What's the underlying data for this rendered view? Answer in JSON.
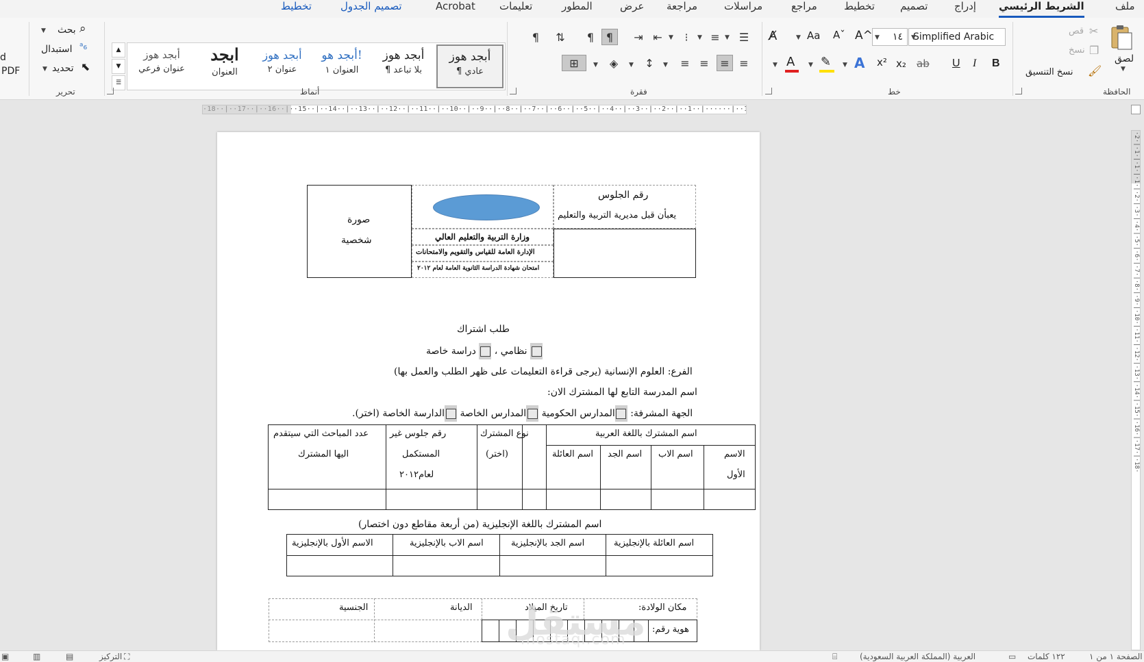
{
  "tabs": {
    "file": "ملف",
    "home": "الشريط الرئيسي",
    "insert": "إدراج",
    "design": "تصميم",
    "layout": "تخطيط",
    "references": "مراجع",
    "mailings": "مراسلات",
    "review": "مراجعة",
    "view": "عرض",
    "developer": "المطور",
    "help": "تعليمات",
    "acrobat": "Acrobat",
    "table_design": "تصميم الجدول",
    "table_layout": "تخطيط"
  },
  "clipboard": {
    "paste": "لصق",
    "cut": "قص",
    "copy": "نسخ",
    "format_painter": "نسخ التنسيق",
    "group": "الحافظة"
  },
  "font": {
    "name": "Simplified Arabic",
    "size": "١٤",
    "group": "خط",
    "grow": "A^",
    "shrink": "Aˇ",
    "case": "Aa",
    "bold": "B",
    "italic": "I",
    "underline": "U",
    "strike": "ab",
    "subscript": "x₂",
    "superscript": "x²",
    "font_color_accent": "#e02020",
    "highlight_accent": "#ffe000"
  },
  "paragraph": {
    "group": "فقرة"
  },
  "styles": {
    "group": "أنماط",
    "items": [
      {
        "sample": "أبجد هوز",
        "name": "¶ عادي"
      },
      {
        "sample": "أبجد هوز",
        "name": "¶ بلا تباعد"
      },
      {
        "sample": "أبجد هو!",
        "name": "العنوان ١"
      },
      {
        "sample": "أبجد هوز",
        "name": "عنوان ٢"
      },
      {
        "sample": "ابجد",
        "name": "العنوان"
      },
      {
        "sample": "أبجد هوز",
        "name": "عنوان فرعي"
      }
    ]
  },
  "editing": {
    "find": "بحث",
    "replace": "استبدال",
    "select": "تحديد",
    "group": "تحرير"
  },
  "pdf": {
    "line1": "d",
    "line2": "PDF"
  },
  "ruler": {
    "text": "·18··|··17··|··16··|··15··|··14··|··13··|··12··|··11··|··10··|··9··|··8··|··7··|··6··|··5··|··4··|··3··|··2··|··1··|······|··1··|··2··|",
    "vtext": "·2·|·1·|·1·|·1·|·2·|·3·|·4·|·5·|·6·|·7·|·8·|·9·|·10·|·11·|·12·|·13·|·14·|·15·|·16·|·17·|·18·"
  },
  "document": {
    "header": {
      "photo_line1": "صورة",
      "photo_line2": "شخصية",
      "seat_number": "رقم الجلوس",
      "seat_note": "يعبأن قبل مديرية التربية والتعليم",
      "ministry": "وزارة التربية والتعليم العالي",
      "department": "الإدارة العامة للقياس والتقويم والامتحانات",
      "exam": "امتحان شهادة الدراسة الثانوية العامة لعام ٢٠١٢",
      "logo_color": "#5b9bd5"
    },
    "form_title": "طلب اشتراك",
    "type_line": {
      "regular": "نظامي ،",
      "private": "دراسة خاصة"
    },
    "branch_line": "الفرع: العلوم الإنسانية (يرجى قراءة التعليمات على ظهر الطلب والعمل بها)",
    "school_line": "اسم المدرسة التابع لها المشترك الان:",
    "authority_line": {
      "label": "الجهة المشرفة:",
      "gov": "المدارس الحكومية",
      "private_schools": "المدارس الخاصة",
      "private_study": "الدارسة الخاصة (اختر)."
    },
    "table1": {
      "arabic_name": "اسم المشترك باللغة العربية",
      "first": "الاسم",
      "first2": "الأول",
      "father": "اسم الاب",
      "grandfather": "اسم الجد",
      "family": "اسم العائلة",
      "type": "نوع المشترك",
      "type2": "(اختر)",
      "seat_old": "رقم جلوس غير",
      "seat_old2": "المستكمل",
      "seat_old3": "لعام٢٠١٢",
      "subjects": "عدد المباحث التي سيتقدم",
      "subjects2": "اليها المشترك"
    },
    "english_title": "اسم المشترك باللغة الإنجليزية (من أربعة مقاطع دون اختصار)",
    "table2": {
      "family_en": "اسم العائلة بالإنجليزية",
      "grandfather_en": "اسم الجد بالإنجليزية",
      "father_en": "اسم الاب بالإنجليزية",
      "first_en": "الاسم الأول بالإنجليزية"
    },
    "table3": {
      "birthplace": "مكان الولادة:",
      "birthdate": "تاريخ الميلاد",
      "religion": "الديانة",
      "nationality": "الجنسية",
      "id_number": "هوية رقم:"
    }
  },
  "watermark": {
    "text": "مستقل",
    "url": "mostaql.com"
  },
  "status": {
    "page": "الصفحة ١ من ١",
    "words": "١٢٢ كلمات",
    "language": "العربية (المملكة العربية السعودية)",
    "focus": "التركيز"
  }
}
